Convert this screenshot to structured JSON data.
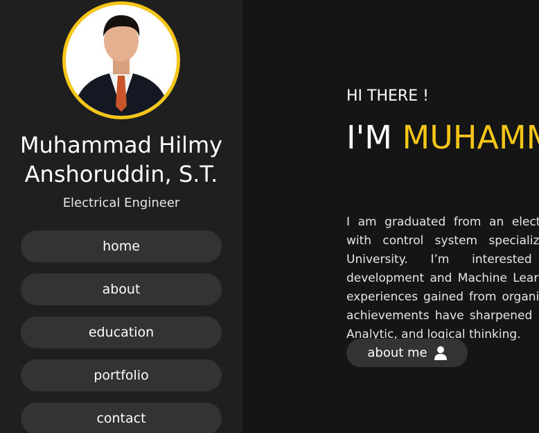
{
  "profile": {
    "name": "Muhammad Hilmy Anshoruddin, S.T.",
    "role": "Electrical Engineer"
  },
  "nav": {
    "items": [
      {
        "label": "home"
      },
      {
        "label": "about"
      },
      {
        "label": "education"
      },
      {
        "label": "portfolio"
      },
      {
        "label": "contact"
      }
    ]
  },
  "hero": {
    "greeting": "HI THERE !",
    "prefix": "I'M",
    "name_highlight": "MUHAMMAD HILMY ANSHORUDDIN",
    "bio": "I am graduated from an electrical engineering with control system specialization at Telkom University. I’m interested in Front-End development and Machine Learning. The various experiences gained from organization, work, and achievements have sharpened my skills, namely Analytic, and logical thinking.",
    "button_label": "about me",
    "button_icon": "user-icon"
  },
  "colors": {
    "accent": "#f5c518",
    "sidebar_bg": "#1f1f1f",
    "main_bg": "#151515",
    "button_bg": "#333333"
  }
}
